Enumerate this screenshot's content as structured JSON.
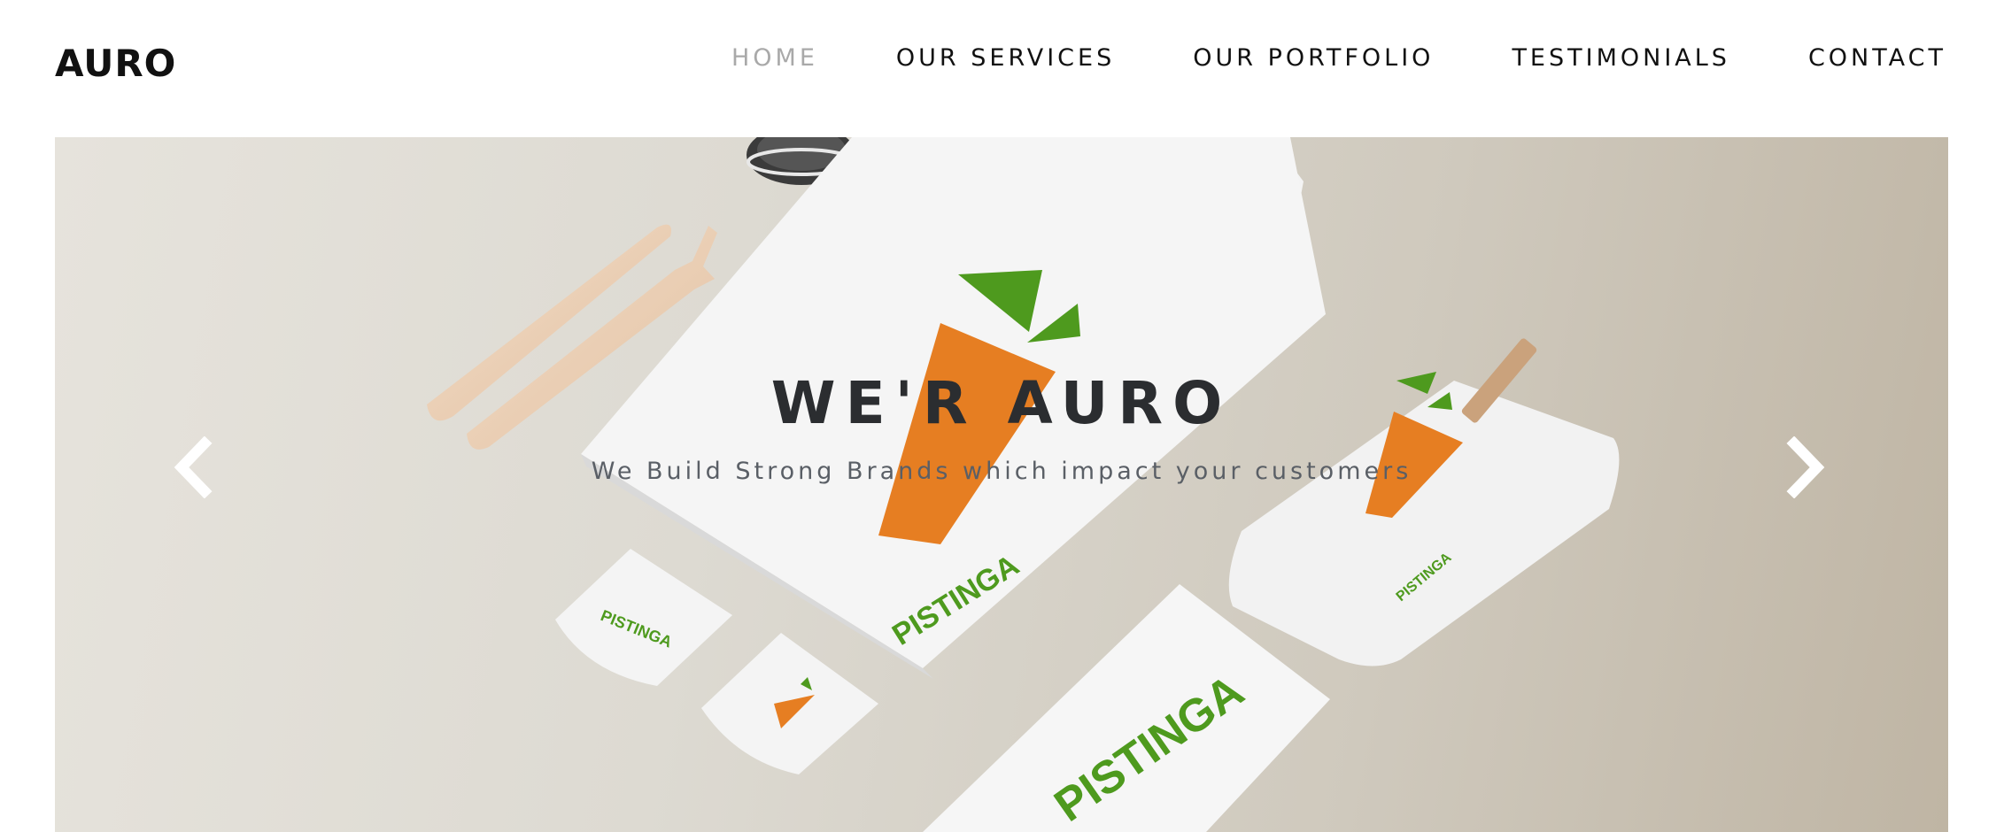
{
  "brand": {
    "name": "AURO"
  },
  "nav": {
    "items": [
      {
        "label": "HOME",
        "active": true
      },
      {
        "label": "OUR SERVICES"
      },
      {
        "label": "OUR PORTFOLIO"
      },
      {
        "label": "TESTIMONIALS"
      },
      {
        "label": "CONTACT"
      }
    ]
  },
  "hero": {
    "title": "WE'R AURO",
    "subtitle": "We Build Strong Brands which impact your customers",
    "mockup_brand": "PISTINGA",
    "prev_icon": "chevron-left-icon",
    "next_icon": "chevron-right-icon"
  },
  "colors": {
    "accent_orange": "#e67e22",
    "accent_green": "#4e9a1e",
    "nav_active": "#a9a9a9",
    "title_text": "#2b2d30"
  }
}
